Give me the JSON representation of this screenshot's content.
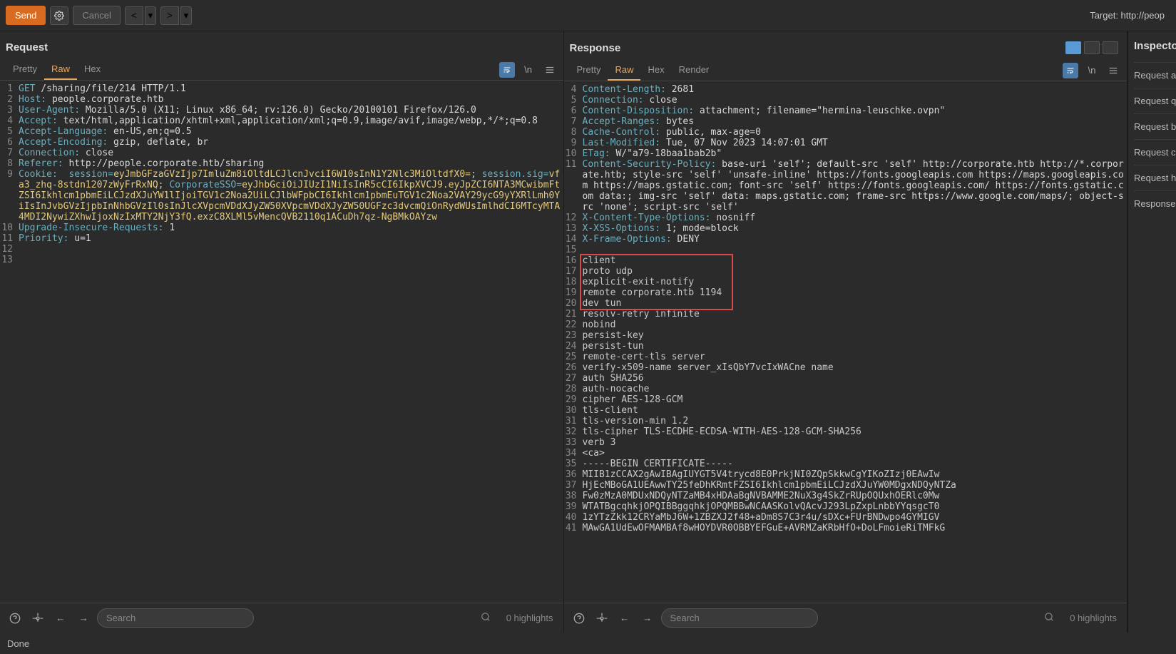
{
  "topbar": {
    "send": "Send",
    "cancel": "Cancel",
    "target": "Target: http://peop"
  },
  "request": {
    "title": "Request",
    "tabs": {
      "pretty": "Pretty",
      "raw": "Raw",
      "hex": "Hex"
    },
    "lines": [
      {
        "n": 1,
        "header": "GET",
        "value": " /sharing/file/214 HTTP/1.1"
      },
      {
        "n": 2,
        "header": "Host:",
        "value": " people.corporate.htb"
      },
      {
        "n": 3,
        "header": "User-Agent:",
        "value": " Mozilla/5.0 (X11; Linux x86_64; rv:126.0) Gecko/20100101 Firefox/126.0"
      },
      {
        "n": 4,
        "header": "Accept:",
        "value": " text/html,application/xhtml+xml,application/xml;q=0.9,image/avif,image/webp,*/*;q=0.8"
      },
      {
        "n": 5,
        "header": "Accept-Language:",
        "value": " en-US,en;q=0.5"
      },
      {
        "n": 6,
        "header": "Accept-Encoding:",
        "value": " gzip, deflate, br"
      },
      {
        "n": 7,
        "header": "Connection:",
        "value": " close"
      },
      {
        "n": 8,
        "header": "Referer:",
        "value": " http://people.corporate.htb/sharing"
      },
      {
        "n": 9,
        "header": "Cookie:",
        "cookie": true,
        "raw": " session=eyJmbGFzaGVzIjp7ImluZm8iOltdLCJlcnJvciI6W10sInN1Y2Nlc3MiOltdfX0=; session.sig=vfa3_zhq-8stdn1207zWyFrRxNQ; CorporateSSO=eyJhbGciOiJIUzI1NiIsInR5cCI6IkpXVCJ9.eyJpZCI6NTA3MCwibmFtZSI6Ikhlcm1pbmEiLCJzdXJuYW1lIjoiTGV1c2Noa2UiLCJlbWFpbCI6Ikhlcm1pbmEuTGV1c2Noa2VAY29ycG9yYXRlLmh0YiIsInJvbGVzIjpbInNhbGVzIl0sInJlcXVpcmVDdXJyZW50XVpcmVDdXJyZW50UGFzc3dvcmQiOnRydWUsImlhdCI6MTcyMTA4MDI2NywiZXhwIjoxNzIxMTY2NjY3fQ.exzC8XLMl5vMencQVB2110q1ACuDh7qz-NgBMkOAYzw"
      },
      {
        "n": 10,
        "header": "Upgrade-Insecure-Requests:",
        "value": " 1"
      },
      {
        "n": 11,
        "header": "Priority:",
        "value": " u=1"
      },
      {
        "n": 12,
        "value": ""
      },
      {
        "n": 13,
        "value": ""
      }
    ],
    "search_placeholder": "Search",
    "highlights": "0 highlights"
  },
  "response": {
    "title": "Response",
    "tabs": {
      "pretty": "Pretty",
      "raw": "Raw",
      "hex": "Hex",
      "render": "Render"
    },
    "lines": [
      {
        "n": 4,
        "header": "Content-Length:",
        "value": " 2681"
      },
      {
        "n": 5,
        "header": "Connection:",
        "value": " close"
      },
      {
        "n": 6,
        "header": "Content-Disposition:",
        "value": " attachment; filename=\"hermina-leuschke.ovpn\""
      },
      {
        "n": 7,
        "header": "Accept-Ranges:",
        "value": " bytes"
      },
      {
        "n": 8,
        "header": "Cache-Control:",
        "value": " public, max-age=0"
      },
      {
        "n": 9,
        "header": "Last-Modified:",
        "value": " Tue, 07 Nov 2023 14:07:01 GMT"
      },
      {
        "n": 10,
        "header": "ETag:",
        "value": " W/\"a79-18baa1bab2b\""
      },
      {
        "n": 11,
        "header": "Content-Security-Policy:",
        "value": " base-uri 'self'; default-src 'self' http://corporate.htb http://*.corporate.htb; style-src 'self' 'unsafe-inline' https://fonts.googleapis.com https://maps.googleapis.com https://maps.gstatic.com; font-src 'self' https://fonts.googleapis.com/ https://fonts.gstatic.com data:; img-src 'self' data: maps.gstatic.com; frame-src https://www.google.com/maps/; object-src 'none'; script-src 'self'"
      },
      {
        "n": 12,
        "header": "X-Content-Type-Options:",
        "value": " nosniff"
      },
      {
        "n": 13,
        "header": "X-XSS-Options:",
        "value": " 1; mode=block"
      },
      {
        "n": 14,
        "header": "X-Frame-Options:",
        "value": " DENY"
      },
      {
        "n": 15,
        "value": ""
      },
      {
        "n": 16,
        "value": "client",
        "box": true
      },
      {
        "n": 17,
        "value": "proto udp",
        "box": true
      },
      {
        "n": 18,
        "value": "explicit-exit-notify",
        "box": true
      },
      {
        "n": 19,
        "value": "remote corporate.htb 1194",
        "box": true
      },
      {
        "n": 20,
        "value": "dev tun",
        "box": true
      },
      {
        "n": 21,
        "value": "resolv-retry infinite"
      },
      {
        "n": 22,
        "value": "nobind"
      },
      {
        "n": 23,
        "value": "persist-key"
      },
      {
        "n": 24,
        "value": "persist-tun"
      },
      {
        "n": 25,
        "value": "remote-cert-tls server"
      },
      {
        "n": 26,
        "value": "verify-x509-name server_xIsQbY7vcIxWACne name"
      },
      {
        "n": 27,
        "value": "auth SHA256"
      },
      {
        "n": 28,
        "value": "auth-nocache"
      },
      {
        "n": 29,
        "value": "cipher AES-128-GCM"
      },
      {
        "n": 30,
        "value": "tls-client"
      },
      {
        "n": 31,
        "value": "tls-version-min 1.2"
      },
      {
        "n": 32,
        "value": "tls-cipher TLS-ECDHE-ECDSA-WITH-AES-128-GCM-SHA256"
      },
      {
        "n": 33,
        "value": "verb 3"
      },
      {
        "n": 34,
        "value": "<ca>"
      },
      {
        "n": 35,
        "value": "-----BEGIN CERTIFICATE-----"
      },
      {
        "n": 36,
        "value": "MIIB1zCCAX2gAwIBAgIUYGT5V4trycd8E0PrkjNI0ZQpSkkwCgYIKoZIzj0EAwIw"
      },
      {
        "n": 37,
        "value": "HjEcMBoGA1UEAwwTY25feDhKRmtFZSI6Ikhlcm1pbmEiLCJzdXJuYW0MDgxNDQyNTZa"
      },
      {
        "n": 38,
        "value": "Fw0zMzA0MDUxNDQyNTZaMB4xHDAaBgNVBAMME2NuX3g4SkZrRUpOQUxhOERlc0Mw"
      },
      {
        "n": 39,
        "value": "WTATBgcqhkjOPQIBBggqhkjOPQMBBwNCAASKolvQAcvJ293LpZxpLnbbYYqsgcT0"
      },
      {
        "n": 40,
        "value": "1zYTzZkk12CRYaMbJ6W+1ZBZXJ2f48+aDm8S7C3r4u/sDXc+FUrBNDwpo4GYMIGV"
      },
      {
        "n": 41,
        "value": "MAwGA1UdEwOFMAMBAf8wHOYDVR0OBBYEFGuE+AVRMZaKRbHfO+DoLFmoieRiTMFkG"
      }
    ],
    "search_placeholder": "Search",
    "highlights": "0 highlights"
  },
  "inspector": {
    "title": "Inspector",
    "items": [
      "Request attributes",
      "Request query",
      "Request body",
      "Request cookies",
      "Request headers",
      "Response headers"
    ]
  },
  "status": "Done"
}
